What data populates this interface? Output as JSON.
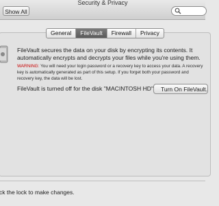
{
  "window": {
    "title": "Security & Privacy"
  },
  "toolbar": {
    "show_all_label": "Show All",
    "search_value": "",
    "search_icon": "search-icon"
  },
  "tabs": [
    {
      "label": "General",
      "selected": false
    },
    {
      "label": "FileVault",
      "selected": true
    },
    {
      "label": "Firewall",
      "selected": false
    },
    {
      "label": "Privacy",
      "selected": false
    }
  ],
  "filevault": {
    "icon": "filevault-icon",
    "description": "FileVault secures the data on your disk by encrypting its contents. It automatically encrypts and decrypts your files while you're using them.",
    "warning_label": "WARNING:",
    "warning_text": " You will need your login password or a recovery key to access your data. A recovery key is automatically generated as part of this setup. If you forget both your password and recovery key, the data will be lost.",
    "status": "FileVault is turned off for the disk \"MACINTOSH HD\".",
    "turn_on_label": "Turn On FileVault..."
  },
  "footer": {
    "lock_text": "ck the lock to make changes."
  },
  "colors": {
    "warning": "#c80000",
    "selected_tab": "#5a5a5a",
    "background": "#e8e8e8"
  }
}
